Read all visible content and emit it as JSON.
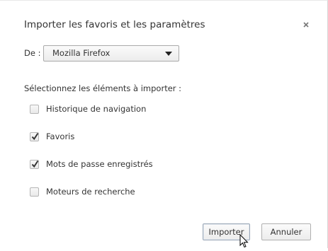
{
  "dialog": {
    "title": "Importer les favoris et les paramètres",
    "close_icon": "close-icon"
  },
  "source": {
    "label": "De :",
    "selected": "Mozilla Firefox"
  },
  "prompt": "Sélectionnez les éléments à importer :",
  "options": [
    {
      "label": "Historique de navigation",
      "checked": false
    },
    {
      "label": "Favoris",
      "checked": true
    },
    {
      "label": "Mots de passe enregistrés",
      "checked": true
    },
    {
      "label": "Moteurs de recherche",
      "checked": false
    }
  ],
  "buttons": {
    "import_label": "Importer",
    "cancel_label": "Annuler"
  },
  "colors": {
    "text": "#333333",
    "checkmark": "#333333"
  }
}
